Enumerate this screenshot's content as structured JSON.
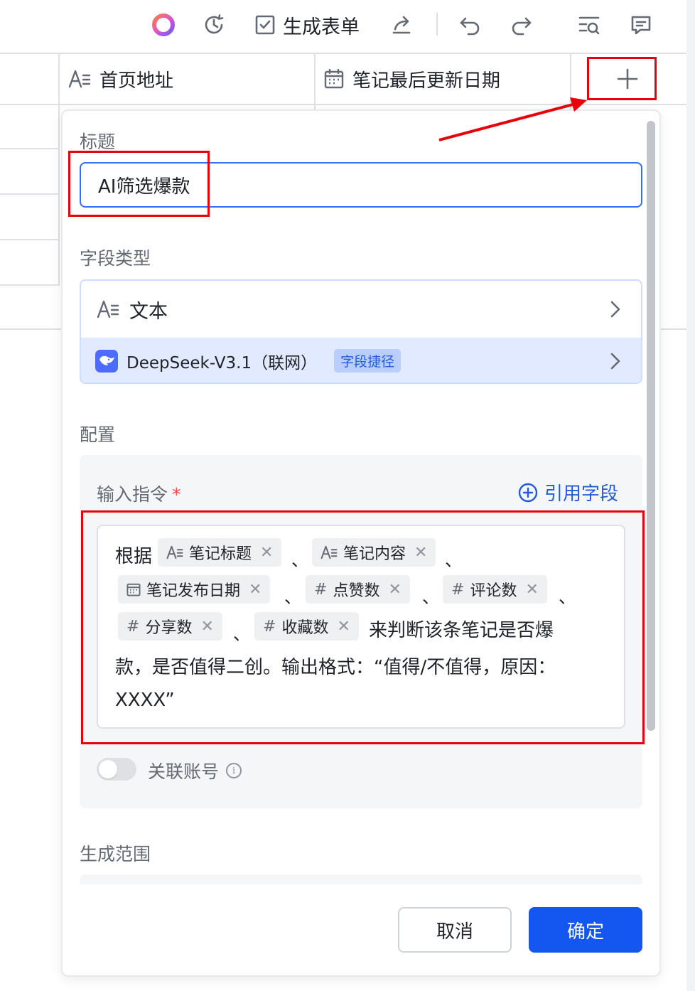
{
  "toolbar": {
    "generate_form_label": "生成表单",
    "icons": [
      "ai-assistant-icon",
      "history-icon",
      "form-check-icon",
      "share-icon",
      "undo-icon",
      "redo-icon",
      "search-list-icon",
      "comment-icon"
    ]
  },
  "columns": [
    {
      "label": "首页地址",
      "icon": "text-field-icon"
    },
    {
      "label": "笔记最后更新日期",
      "icon": "date-field-icon"
    }
  ],
  "dialog": {
    "title_section_label": "标题",
    "title_value": "AI筛选爆款",
    "field_type_section_label": "字段类型",
    "field_type": "文本",
    "shortcut_name": "DeepSeek-V3.1（联网）",
    "shortcut_tag": "字段捷径",
    "config_section_label": "配置",
    "prompt_label": "输入指令",
    "required_mark": "*",
    "reference_field_label": "引用字段",
    "prompt": {
      "prefix": "根据",
      "chips": [
        "笔记标题",
        "笔记内容",
        "笔记发布日期",
        "点赞数",
        "评论数",
        "分享数",
        "收藏数"
      ],
      "separator": "、",
      "line3_suffix": "来判断该条笔记是否爆",
      "line4": "款，是否值得二创。输出格式：“值得/不值得，原因：",
      "line5": "XXXX”"
    },
    "link_account_label": "关联账号",
    "link_account_enabled": false,
    "range_section_label": "生成范围",
    "cancel_label": "取消",
    "confirm_label": "确定"
  },
  "colors": {
    "accent": "#1456f0",
    "link": "#245bdb",
    "annotation_red": "#e8000b",
    "shortcut_bg": "#e1eaff"
  }
}
